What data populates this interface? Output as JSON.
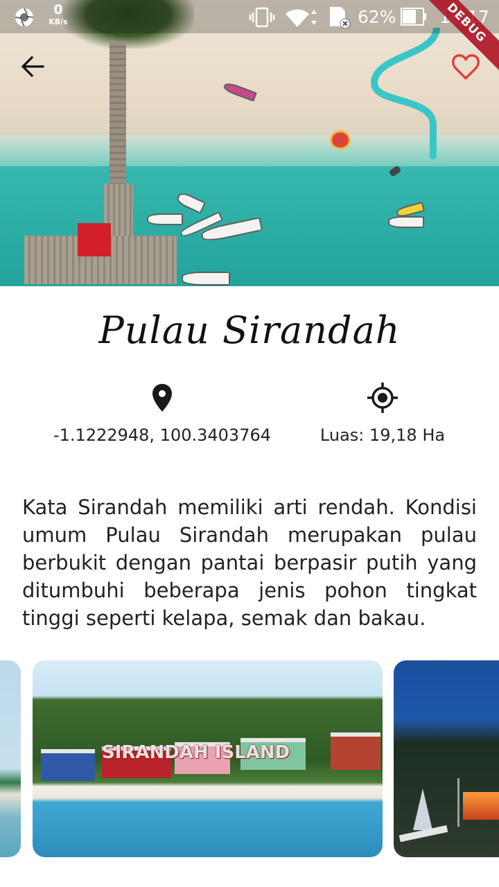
{
  "status_bar": {
    "net_speed_value": "0",
    "net_speed_unit": "KB/s",
    "battery": "62%",
    "time": "19:17",
    "debug_banner": "DEBUG"
  },
  "header": {
    "back_icon": "arrow-left-icon",
    "favorite_icon": "heart-outline-icon",
    "accent_color": "#e0403a"
  },
  "place": {
    "title": "Pulau Sirandah",
    "coordinates": "-1.1222948, 100.3403764",
    "area": "Luas: 19,18 Ha",
    "location_icon": "map-pin-icon",
    "area_icon": "crosshair-icon",
    "description": "Kata Sirandah memiliki arti rendah. Kondisi umum Pulau Sirandah merupakan pulau berbukit dengan pantai berpasir putih yang ditumbuhi beberapa jenis pohon tingkat tinggi seperti kelapa, semak dan bakau."
  },
  "gallery": {
    "sign_text": "SIRANDAH ISLAND"
  }
}
